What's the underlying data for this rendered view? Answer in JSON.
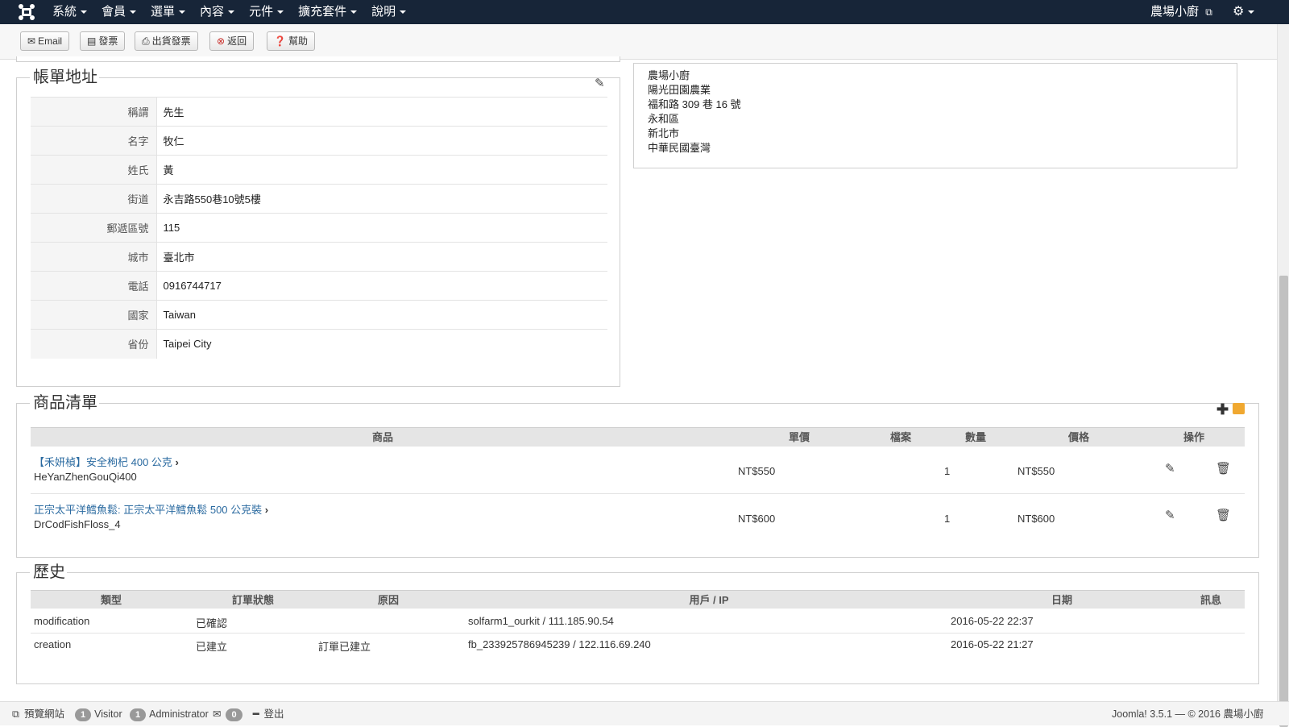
{
  "topbar": {
    "menu": [
      "系統",
      "會員",
      "選單",
      "內容",
      "元件",
      "擴充套件",
      "說明"
    ],
    "site_name": "農場小廚"
  },
  "toolbar": {
    "email": "Email",
    "invoice": "發票",
    "delivery_invoice": "出貨發票",
    "back": "返回",
    "help": "幫助"
  },
  "billing": {
    "legend": "帳單地址",
    "rows": [
      {
        "label": "稱謂",
        "value": "先生"
      },
      {
        "label": "名字",
        "value": "牧仁"
      },
      {
        "label": "姓氏",
        "value": "黃"
      },
      {
        "label": "街道",
        "value": "永吉路550巷10號5樓"
      },
      {
        "label": "郵遞區號",
        "value": "115"
      },
      {
        "label": "城市",
        "value": "臺北市"
      },
      {
        "label": "電話",
        "value": "0916744717"
      },
      {
        "label": "國家",
        "value": "Taiwan"
      },
      {
        "label": "省份",
        "value": "Taipei City"
      }
    ]
  },
  "store_address": [
    "農場小廚",
    "陽光田園農業",
    "福和路 309 巷 16 號",
    "永和區",
    "新北市",
    "中華民國臺灣"
  ],
  "products": {
    "legend": "商品清單",
    "headers": {
      "product": "商品",
      "unit_price": "單價",
      "file": "檔案",
      "qty": "數量",
      "price": "價格",
      "action": "操作"
    },
    "rows": [
      {
        "name": "【禾妍楨】安全枸杞 400 公克",
        "code": "HeYanZhenGouQi400",
        "unit_price": "NT$550",
        "qty": "1",
        "price": "NT$550"
      },
      {
        "name": "正宗太平洋鱈魚鬆: 正宗太平洋鱈魚鬆 500 公克裝",
        "code": "DrCodFishFloss_4",
        "unit_price": "NT$600",
        "qty": "1",
        "price": "NT$600"
      }
    ]
  },
  "history": {
    "legend": "歷史",
    "headers": {
      "type": "類型",
      "status": "訂單狀態",
      "reason": "原因",
      "user_ip": "用戶 / IP",
      "date": "日期",
      "message": "訊息"
    },
    "rows": [
      {
        "type": "modification",
        "status": "已確認",
        "reason": "",
        "user_ip": "solfarm1_ourkit / 111.185.90.54",
        "date": "2016-05-22 22:37",
        "message": ""
      },
      {
        "type": "creation",
        "status": "已建立",
        "reason": "訂單已建立",
        "user_ip": "fb_233925786945239 / 122.116.69.240",
        "date": "2016-05-22 21:27",
        "message": ""
      }
    ]
  },
  "footer": {
    "preview": "預覽網站",
    "visitor_count": "1",
    "visitor_label": "Visitor",
    "admin_count": "1",
    "admin_label": "Administrator",
    "message_count": "0",
    "logout": "登出",
    "copyright": "Joomla! 3.5.1 — © 2016 農場小廚"
  }
}
